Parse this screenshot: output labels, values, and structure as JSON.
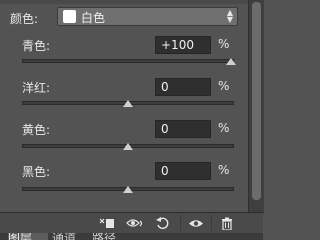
{
  "preset": {
    "label": "颜色:",
    "selected": "白色"
  },
  "rows": [
    {
      "label": "青色:",
      "value": "+100",
      "unit": "%",
      "slider": 1.0
    },
    {
      "label": "洋红:",
      "value": "0",
      "unit": "%",
      "slider": 0.5
    },
    {
      "label": "黄色:",
      "value": "0",
      "unit": "%",
      "slider": 0.5
    },
    {
      "label": "黑色:",
      "value": "0",
      "unit": "%",
      "slider": 0.5
    }
  ],
  "toolbar": {
    "clip_icon": "clip-to-layer-icon",
    "previous_state_icon": "view-previous-state-icon",
    "reset_icon": "reset-icon",
    "visibility_icon": "eye-icon",
    "delete_icon": "trash-icon"
  },
  "tabs": [
    "图层",
    "通道",
    "路径"
  ]
}
